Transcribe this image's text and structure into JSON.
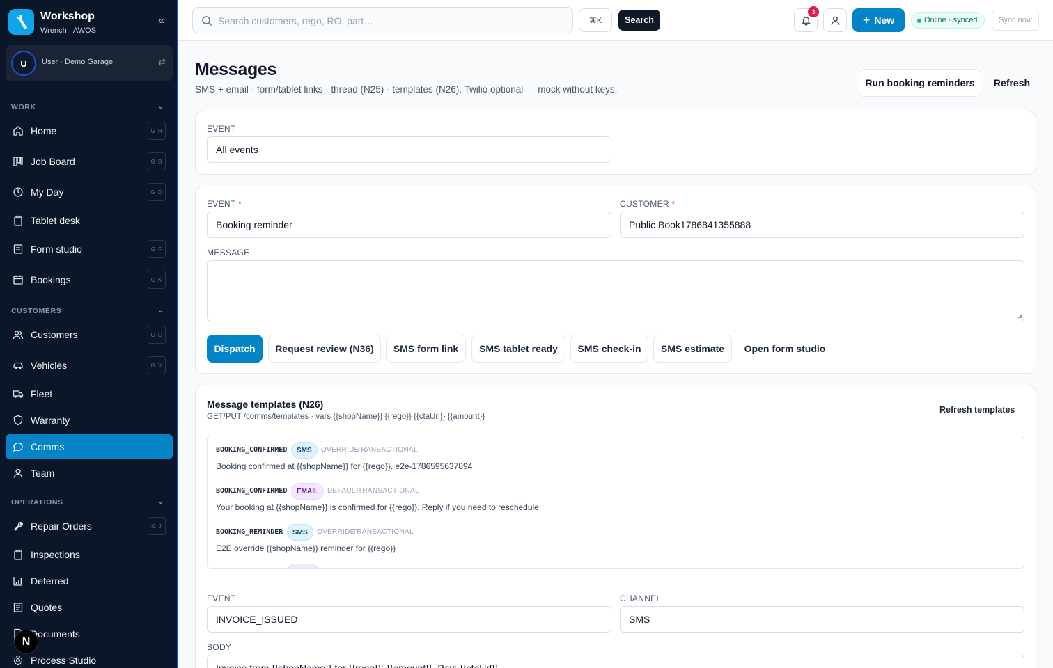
{
  "sidebar": {
    "brand_title": "Workshop",
    "brand_sub": "Wrench · AWOS",
    "user_initial": "U",
    "user_text": "User · Demo Garage",
    "sections": {
      "work": "WORK",
      "customers": "CUSTOMERS",
      "operations": "OPERATIONS"
    },
    "items": [
      {
        "label": "Home",
        "kbd": "G H",
        "icon": "home-icon"
      },
      {
        "label": "Job Board",
        "kbd": "G B",
        "icon": "board-icon"
      },
      {
        "label": "My Day",
        "kbd": "G D",
        "icon": "clock-icon"
      },
      {
        "label": "Tablet desk",
        "kbd": "",
        "icon": "clipboard-icon"
      },
      {
        "label": "Form studio",
        "kbd": "G F",
        "icon": "form-icon"
      },
      {
        "label": "Bookings",
        "kbd": "G K",
        "icon": "calendar-icon"
      },
      {
        "label": "Customers",
        "kbd": "G C",
        "icon": "users-icon"
      },
      {
        "label": "Vehicles",
        "kbd": "G V",
        "icon": "car-icon"
      },
      {
        "label": "Fleet",
        "kbd": "",
        "icon": "truck-icon"
      },
      {
        "label": "Warranty",
        "kbd": "",
        "icon": "shield-icon"
      },
      {
        "label": "Comms",
        "kbd": "",
        "icon": "message-icon"
      },
      {
        "label": "Team",
        "kbd": "",
        "icon": "user-icon"
      },
      {
        "label": "Repair Orders",
        "kbd": "G J",
        "icon": "wrench-icon"
      },
      {
        "label": "Inspections",
        "kbd": "",
        "icon": "clipboard-icon"
      },
      {
        "label": "Deferred",
        "kbd": "",
        "icon": "chart-icon"
      },
      {
        "label": "Quotes",
        "kbd": "",
        "icon": "quote-icon"
      },
      {
        "label": "Documents",
        "kbd": "",
        "icon": "document-icon"
      },
      {
        "label": "Process Studio",
        "kbd": "",
        "icon": "gear-icon"
      }
    ],
    "n_badge": "N"
  },
  "topbar": {
    "search_placeholder": "Search customers, rego, RO, part…",
    "kbd_hint": "⌘K",
    "search_label": "Search",
    "notif_count": "3",
    "new_label": "New",
    "status_label": "Online · synced",
    "sync_label": "Sync now"
  },
  "page": {
    "title": "Messages",
    "subtitle": "SMS + email · form/tablet links · thread (N25) · templates (N26). Twilio optional — mock without keys.",
    "run_reminders": "Run booking reminders",
    "refresh": "Refresh"
  },
  "filter": {
    "event_label": "EVENT",
    "event_value": "All events"
  },
  "compose": {
    "event_label": "EVENT",
    "event_value": "Booking reminder",
    "customer_label": "CUSTOMER",
    "customer_value": "Public Book1786841355888",
    "message_label": "MESSAGE",
    "message_value": "",
    "required_mark": "*",
    "buttons": {
      "dispatch": "Dispatch",
      "request_review": "Request review (N36)",
      "sms_form_link": "SMS form link",
      "sms_tablet_ready": "SMS tablet ready",
      "sms_checkin": "SMS check-in",
      "sms_estimate": "SMS estimate",
      "open_form_studio": "Open form studio"
    }
  },
  "templates": {
    "title": "Message templates (N26)",
    "subtitle": "GET/PUT /comms/templates · vars {{shopName}} {{rego}} {{ctaUrl}} {{amount}}",
    "refresh_label": "Refresh templates",
    "rows": [
      {
        "code": "BOOKING_CONFIRMED",
        "channel": "SMS",
        "source": "OVERRIDE",
        "kind": "TRANSACTIONAL",
        "body": "Booking confirmed at {{shopName}} for {{rego}}. e2e-1786595637894"
      },
      {
        "code": "BOOKING_CONFIRMED",
        "channel": "EMAIL",
        "source": "DEFAULT",
        "kind": "TRANSACTIONAL",
        "body": "Your booking at {{shopName}} is confirmed for {{rego}}. Reply if you need to reschedule."
      },
      {
        "code": "BOOKING_REMINDER",
        "channel": "SMS",
        "source": "OVERRIDE",
        "kind": "TRANSACTIONAL",
        "body": "E2E override {{shopName}} reminder for {{rego}}"
      }
    ],
    "editor": {
      "event_label": "EVENT",
      "event_value": "INVOICE_ISSUED",
      "channel_label": "CHANNEL",
      "channel_value": "SMS",
      "body_label": "BODY",
      "body_value": "Invoice from {{shopName}} for {{rego}}: {{amount}}. Pay: {{ctaUrl}}"
    }
  },
  "colors": {
    "sidebar_bg": "#0b1628",
    "accent": "#0284c7",
    "active_item": "#0284c7",
    "notif": "#e11d48",
    "online": "#10b981"
  }
}
